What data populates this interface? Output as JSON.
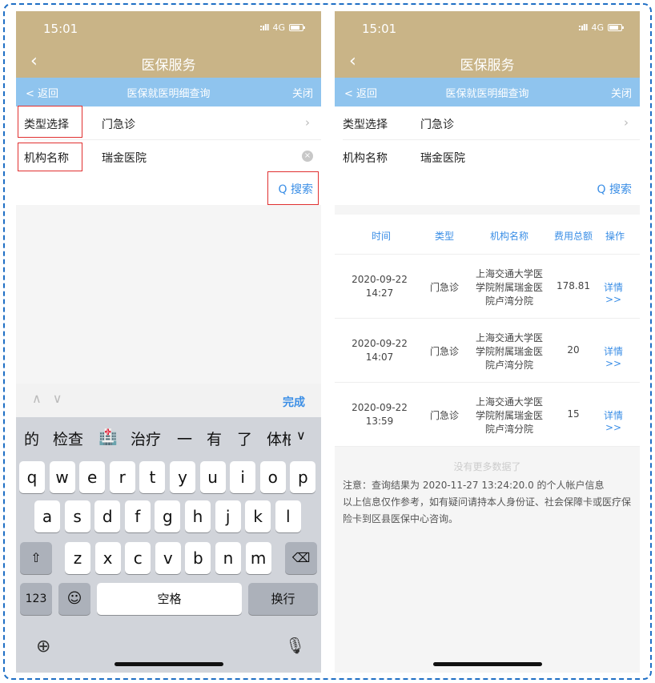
{
  "status": {
    "time": "15:01",
    "network": "4G"
  },
  "nav": {
    "title": "医保服务"
  },
  "subbar": {
    "back": "< 返回",
    "title": "医保就医明细查询",
    "close": "关闭"
  },
  "form": {
    "type_label": "类型选择",
    "type_value": "门急诊",
    "org_label": "机构名称",
    "org_value": "瑞金医院"
  },
  "search_label": "Q 搜索",
  "keyboard": {
    "done": "完成",
    "candidates": [
      "的",
      "检查",
      "🏥",
      "治疗",
      "一",
      "有",
      "了",
      "体柏"
    ],
    "row1": [
      "q",
      "w",
      "e",
      "r",
      "t",
      "y",
      "u",
      "i",
      "o",
      "p"
    ],
    "row2": [
      "a",
      "s",
      "d",
      "f",
      "g",
      "h",
      "j",
      "k",
      "l"
    ],
    "row3": [
      "z",
      "x",
      "c",
      "v",
      "b",
      "n",
      "m"
    ],
    "num": "123",
    "space": "空格",
    "return": "换行"
  },
  "table": {
    "headers": [
      "时间",
      "类型",
      "机构名称",
      "费用总额",
      "操作"
    ],
    "rows": [
      {
        "date": "2020-09-22",
        "time": "14:27",
        "type": "门急诊",
        "org1": "上海交通大学医",
        "org2": "学院附属瑞金医",
        "org3": "院卢湾分院",
        "amount": "178.81",
        "action": "详情>>"
      },
      {
        "date": "2020-09-22",
        "time": "14:07",
        "type": "门急诊",
        "org1": "上海交通大学医",
        "org2": "学院附属瑞金医",
        "org3": "院卢湾分院",
        "amount": "20",
        "action": "详情>>"
      },
      {
        "date": "2020-09-22",
        "time": "13:59",
        "type": "门急诊",
        "org1": "上海交通大学医",
        "org2": "学院附属瑞金医",
        "org3": "院卢湾分院",
        "amount": "15",
        "action": "详情>>"
      }
    ]
  },
  "no_more": "没有更多数据了",
  "note": {
    "line1": "注意：查询结果为 2020-11-27 13:24:20.0 的个人帐户信息",
    "line2": "以上信息仅作参考，如有疑问请持本人身份证、社会保障卡或医疗保",
    "line3": "险卡到区县医保中心咨询。"
  }
}
